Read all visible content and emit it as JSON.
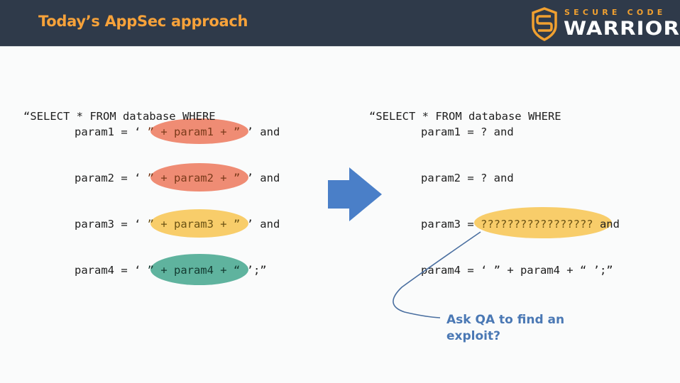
{
  "header": {
    "title": "Today’s AppSec approach",
    "logo": {
      "top_text": "SECURE CODE",
      "bottom_text": "WARRIOR",
      "icon": "shield-s-icon"
    }
  },
  "colors": {
    "header_bg": "#2f3a4a",
    "title": "#f7a23a",
    "highlight_red": "#ef8c74",
    "highlight_yellow": "#f8cd6a",
    "highlight_green": "#5fb39e",
    "arrow": "#4a7fc8",
    "callout": "#4a78b4"
  },
  "left_code": {
    "first_line": "“SELECT * FROM database WHERE",
    "lines": [
      {
        "prefix": "param1 = ‘ ",
        "highlight": "” + param1 + ”",
        "suffix": " ’ and",
        "color": "red"
      },
      {
        "prefix": "param2 = ‘ ",
        "highlight": "” + param2 + ”",
        "suffix": " ’ and",
        "color": "red"
      },
      {
        "prefix": "param3 = ‘ ",
        "highlight": "” + param3 + ”",
        "suffix": " ’ and",
        "color": "yellow"
      },
      {
        "prefix": "param4 = ‘ ",
        "highlight": "” + param4 + “",
        "suffix": " ’;”",
        "color": "green"
      }
    ]
  },
  "arrow": {
    "icon": "right-arrow-icon"
  },
  "right_code": {
    "first_line": "“SELECT * FROM database WHERE",
    "lines": [
      "param1 = ? and",
      "param2 = ? and",
      "param3 = ",
      "param4 = ‘ ” + param4 + “ ’;”"
    ],
    "param3_highlight": "?????????????????",
    "param3_suffix": " and"
  },
  "callout": {
    "text": "Ask QA to find an exploit?"
  }
}
